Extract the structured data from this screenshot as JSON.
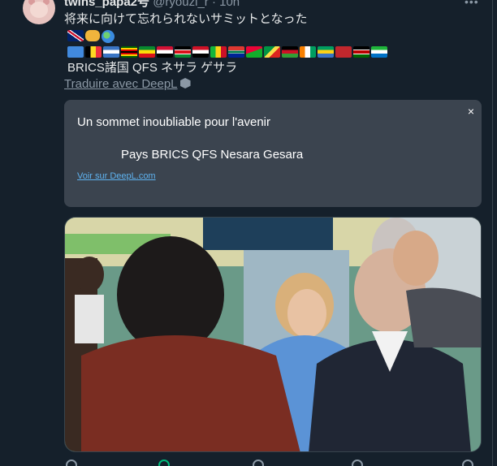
{
  "tweet": {
    "display_name": "twins_papa2号",
    "handle": "@ryouzi_r · 10h",
    "text": "将来に向けて忘れられないサミットとなった",
    "brics_line": "BRICS諸国 QFS ネサラ ゲサラ"
  },
  "translate": {
    "link_label": "Traduire avec DeepL",
    "line1": "Un sommet inoubliable pour l'avenir",
    "line2": "Pays BRICS QFS Nesara Gesara",
    "deepl_link": "Voir sur DeepL.com",
    "close": "×"
  },
  "icons": {
    "more": "more-icon",
    "close": "close-icon",
    "deepl": "deepl-icon"
  },
  "colors": {
    "background": "#15202b",
    "card": "#3b444f",
    "link": "#5fb3f0",
    "muted": "#8b98a5"
  }
}
